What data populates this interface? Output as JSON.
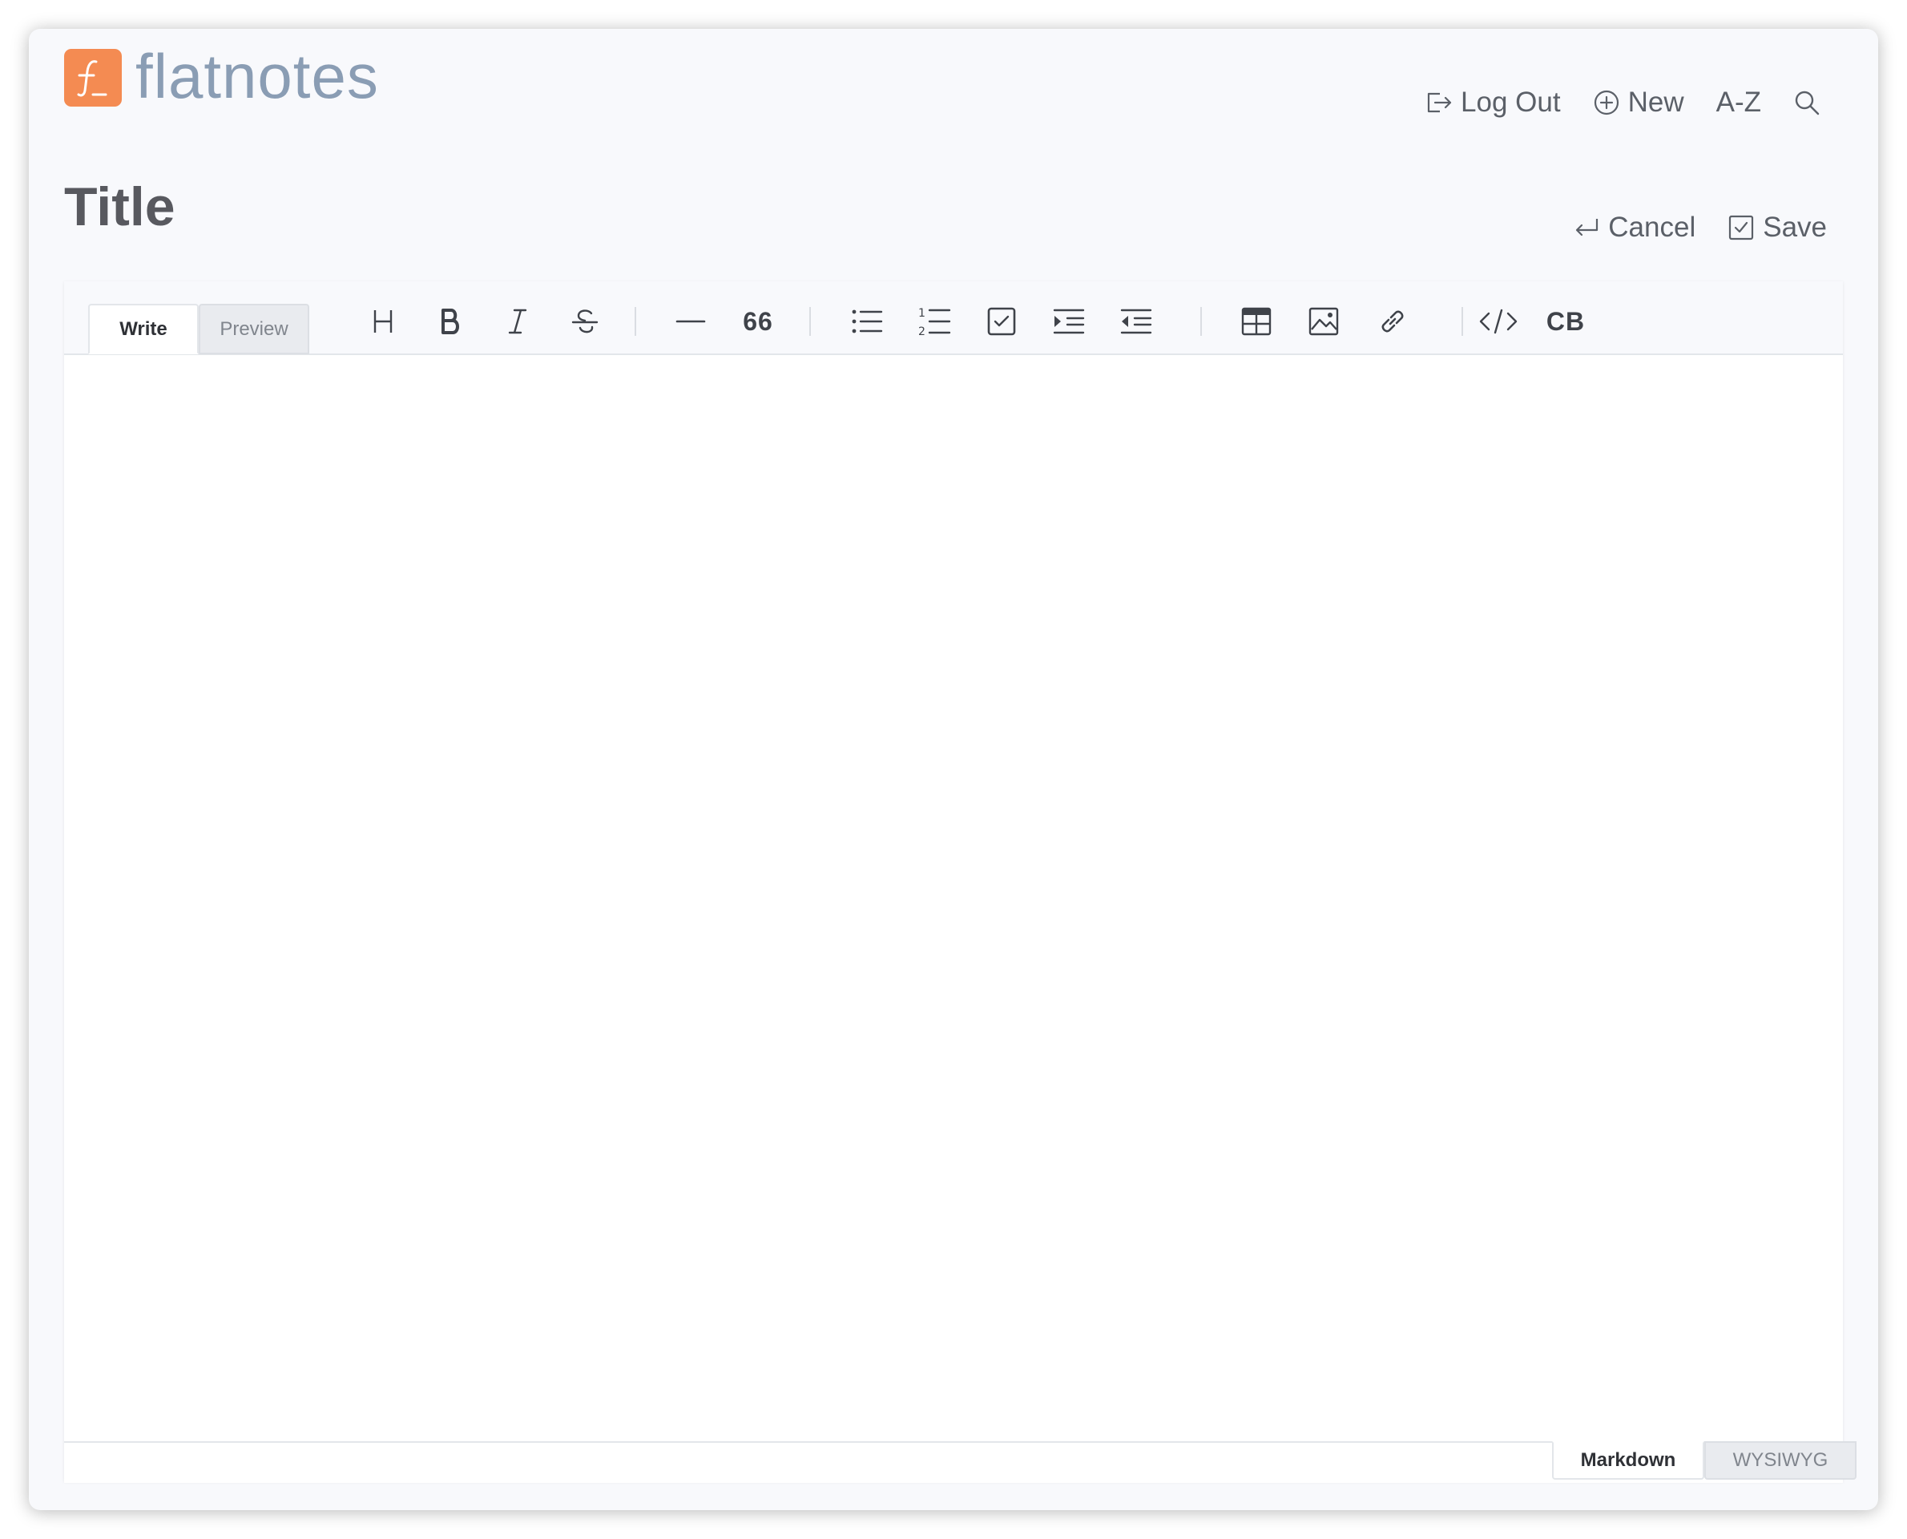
{
  "app": {
    "name": "flatnotes",
    "brand_color": "#f48b52",
    "logo_icon": "flatnotes-logo-icon"
  },
  "header": {
    "nav": [
      {
        "label": "Log Out",
        "icon": "logout-icon"
      },
      {
        "label": "New",
        "icon": "plus-circle-icon"
      },
      {
        "label": "A-Z",
        "icon": ""
      },
      {
        "label": "",
        "icon": "search-icon"
      }
    ]
  },
  "note": {
    "title": "Title",
    "actions": {
      "cancel_label": "Cancel",
      "save_label": "Save"
    },
    "content": ""
  },
  "editor": {
    "tabs": {
      "write": "Write",
      "preview": "Preview",
      "active": "Write"
    },
    "toolbar": [
      {
        "icon": "heading-icon"
      },
      {
        "icon": "bold-icon"
      },
      {
        "icon": "italic-icon"
      },
      {
        "icon": "strikethrough-icon"
      },
      {
        "icon": "horizontal-rule-icon"
      },
      {
        "icon": "quote-icon",
        "text": "66"
      },
      {
        "icon": "bullet-list-icon"
      },
      {
        "icon": "ordered-list-icon"
      },
      {
        "icon": "task-list-icon"
      },
      {
        "icon": "indent-icon"
      },
      {
        "icon": "outdent-icon"
      },
      {
        "icon": "table-icon"
      },
      {
        "icon": "image-icon"
      },
      {
        "icon": "link-icon"
      },
      {
        "icon": "code-icon"
      },
      {
        "icon": "code-block-icon",
        "text": "CB"
      }
    ],
    "modes": {
      "markdown": "Markdown",
      "wysiwyg": "WYSIWYG",
      "active": "Markdown"
    }
  }
}
